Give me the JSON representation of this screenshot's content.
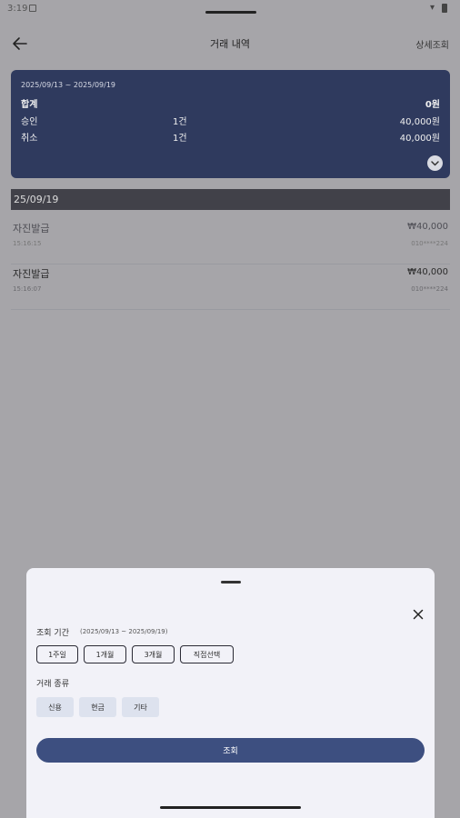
{
  "status": {
    "time": "3:19",
    "wifi_icon": "wifi-icon",
    "battery_icon": "battery-icon"
  },
  "app_bar": {
    "title": "거래 내역",
    "detail_link": "상세조회",
    "back_icon": "arrow-left-icon"
  },
  "summary": {
    "date_range": "2025/09/13 ~ 2025/09/19",
    "total_label": "합계",
    "total_amount": "0원",
    "rows": [
      {
        "label": "승인",
        "count": "1건",
        "amount": "40,000원"
      },
      {
        "label": "취소",
        "count": "1건",
        "amount": "40,000원"
      }
    ],
    "expand_icon": "chevron-down-icon",
    "card_color": "#2f3a5e"
  },
  "transactions": {
    "date_header": "25/09/19",
    "items": [
      {
        "name": "자진발급",
        "time": "15:16:15",
        "amount": "₩40,000",
        "phone": "010****224"
      },
      {
        "name": "자진발급",
        "time": "15:16:07",
        "amount": "₩40,000",
        "phone": "010****224"
      }
    ]
  },
  "sheet": {
    "close_icon": "close-icon",
    "period_label": "조회 기간",
    "period_range": "(2025/09/13 ~ 2025/09/19)",
    "period_options": [
      "1주일",
      "1개월",
      "3개월",
      "직접선택"
    ],
    "type_label": "거래 종류",
    "type_options": [
      "신용",
      "현금",
      "기타"
    ],
    "search_button": "조회",
    "accent_color": "#3d4f80"
  }
}
